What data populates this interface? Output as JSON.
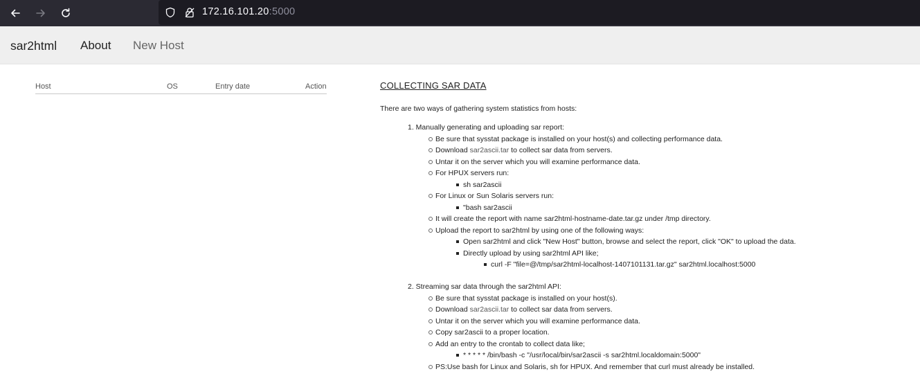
{
  "browser": {
    "url_host": "172.16.101.20",
    "url_port": ":5000"
  },
  "navbar": {
    "brand": "sar2html",
    "about": "About",
    "new_host": "New Host"
  },
  "host_table": {
    "columns": [
      "Host",
      "OS",
      "Entry date",
      "Action"
    ]
  },
  "content": {
    "heading": "COLLECTING SAR DATA",
    "intro": "There are two ways of gathering system statistics from hosts:",
    "section1": {
      "title": "1. Manually generating and uploading sar report:",
      "items": [
        "Be sure that sysstat package is installed on your host(s) and collecting performance data.",
        "to collect sar data from servers.",
        "Untar it on the server which you will examine performance data.",
        "For HPUX servers run:",
        "sh sar2ascii",
        "For Linux or Sun Solaris servers run:",
        "\"bash sar2ascii",
        "It will create the report with name sar2html-hostname-date.tar.gz under /tmp directory.",
        "Upload the report to sar2html by using one of the following ways:",
        "Open sar2html and click \"New Host\" button, browse and select the report, click \"OK\" to upload the data.",
        "Directly upload by using sar2html API like;",
        "curl -F \"file=@/tmp/sar2html-localhost-1407101131.tar.gz\" sar2html.localhost:5000"
      ],
      "download_prefix": "Download",
      "download_link": "sar2ascii.tar"
    },
    "section2": {
      "title": "2. Streaming sar data through the sar2html API:",
      "items": [
        "Be sure that sysstat package is installed on your host(s).",
        "to collect sar data from servers.",
        "Untar it on the server which you will examine performance data.",
        "Copy sar2ascii to a proper location.",
        "Add an entry to the crontab to collect data like;",
        "* * * * * /bin/bash -c \"/usr/local/bin/sar2ascii -s sar2html.localdomain:5000\"",
        "PS:Use bash for Linux and Solaris, sh for HPUX. And remember that curl must already be installed."
      ],
      "download_prefix": "Download",
      "download_link": "sar2ascii.tar"
    }
  }
}
